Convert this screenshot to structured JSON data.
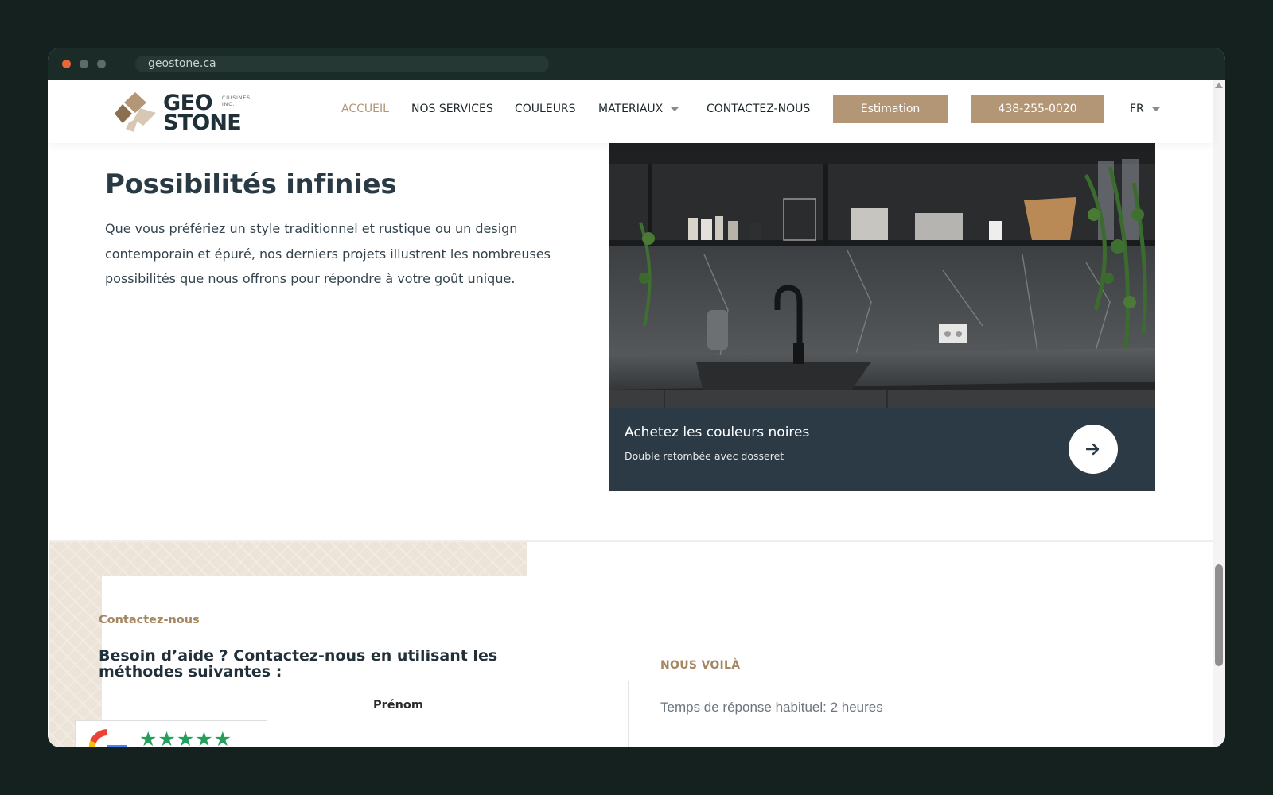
{
  "browser": {
    "url": "geostone.ca"
  },
  "header": {
    "logo": {
      "line1": "GEO",
      "line2": "STONE",
      "tagline": "CUISINES INC.",
      "colors": [
        "#b29676",
        "#8c6f50",
        "#d8c7b3"
      ]
    },
    "nav": {
      "home": "ACCUEIL",
      "services": "NOS SERVICES",
      "colors": "COULEURS",
      "materials": "MATERIAUX",
      "contact": "CONTACTEZ-NOUS"
    },
    "estimate_button": "Estimation",
    "phone_button": "438-255-0020",
    "language": "FR"
  },
  "hero": {
    "title": "Possibilités infinies",
    "text": "Que vous préfériez un style traditionnel et rustique ou un design contemporain et épuré, nos derniers projets illustrent les nombreuses possibilités que nous offrons pour répondre à votre goût unique.",
    "image_icon": "kitchen-photo",
    "card_title": "Achetez les couleurs noires",
    "card_subtitle": "Double retombée avec dosseret",
    "card_button_icon": "arrow-right-icon"
  },
  "contact": {
    "eyebrow": "Contactez-nous",
    "title": "Besoin d’aide ? Contactez-nous en utilisant les méthodes suivantes :",
    "first_name_label": "Prénom",
    "here_label": "NOUS VOILÀ",
    "response_time": "Temps de réponse habituel: 2 heures"
  },
  "review_badge": {
    "icon": "google-icon",
    "stars": "★★★★★",
    "star_color": "#23a05a"
  },
  "theme": {
    "accent": "#b29676",
    "dark": "#2b3a45",
    "page_bg": "#14211f"
  }
}
